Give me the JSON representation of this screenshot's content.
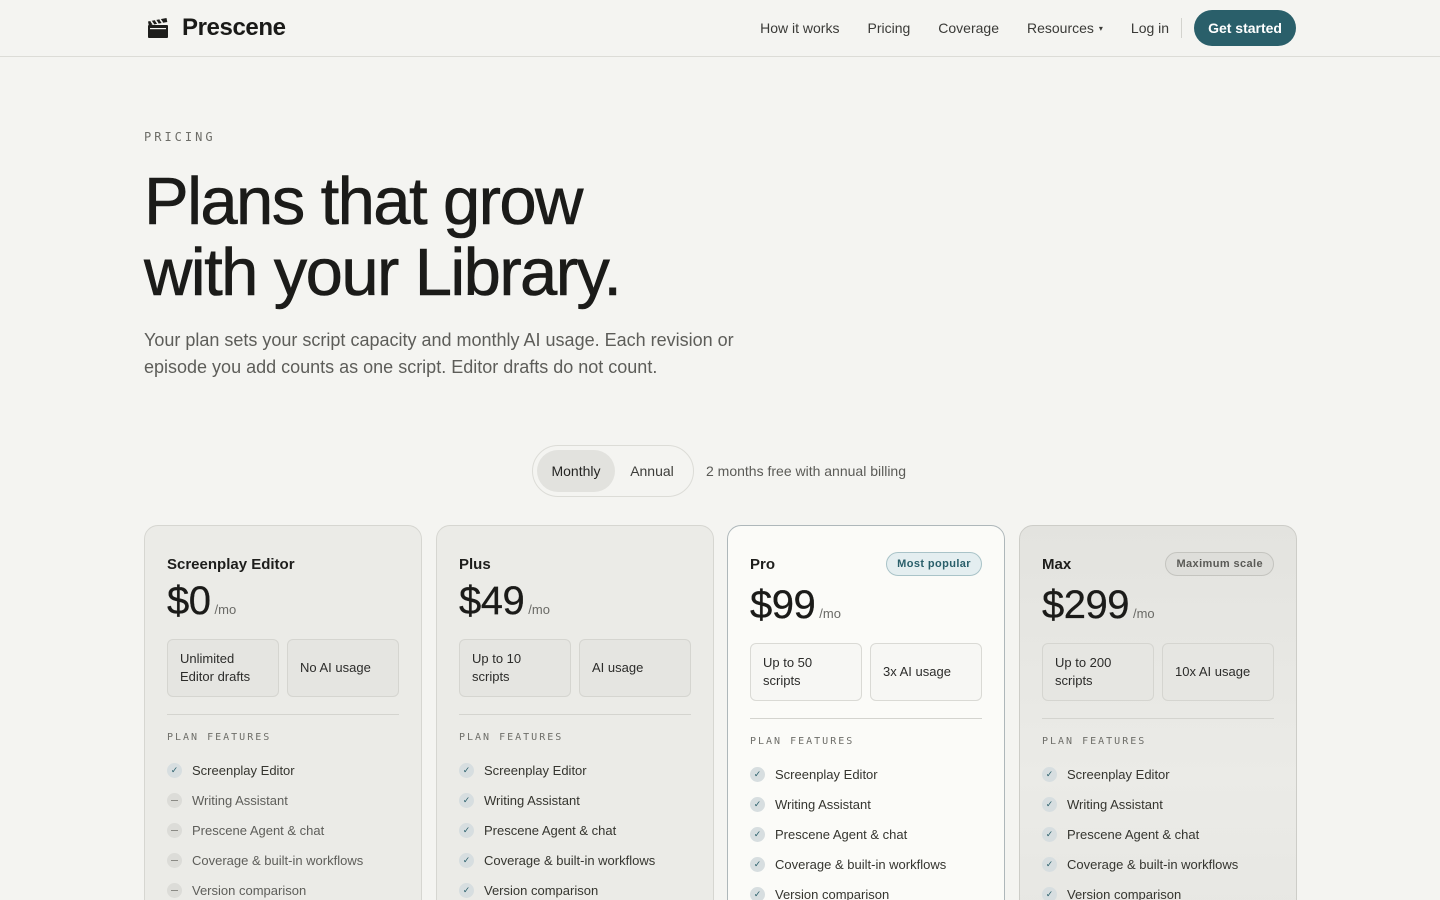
{
  "nav": {
    "brand": "Prescene",
    "brand_icon": "clapperboard-icon",
    "links": [
      "How it works",
      "Pricing",
      "Coverage",
      "Resources"
    ],
    "resources_caret": "▾",
    "login": "Log in",
    "cta": "Get started"
  },
  "hero": {
    "eyebrow": "PRICING",
    "title_line1": "Plans that grow",
    "title_line2": "with your Library.",
    "subtitle": "Your plan sets your script capacity and monthly AI usage. Each revision or episode you add counts as one script. Editor drafts do not count."
  },
  "billing": {
    "monthly": "Monthly",
    "annual": "Annual",
    "selected": "Monthly",
    "note": "2 months free with annual billing"
  },
  "plans": [
    {
      "name": "Screenplay Editor",
      "price": "$0",
      "per": "/mo",
      "stat1": "Unlimited Editor drafts",
      "stat2": "No AI usage",
      "features_title": "PLAN FEATURES",
      "features": [
        {
          "label": "Screenplay Editor",
          "included": true
        },
        {
          "label": "Writing Assistant",
          "included": false
        },
        {
          "label": "Prescene Agent & chat",
          "included": false
        },
        {
          "label": "Coverage & built-in workflows",
          "included": false
        },
        {
          "label": "Version comparison",
          "included": false
        }
      ]
    },
    {
      "name": "Plus",
      "price": "$49",
      "per": "/mo",
      "stat1": "Up to 10 scripts",
      "stat2": "AI usage",
      "features_title": "PLAN FEATURES",
      "features": [
        {
          "label": "Screenplay Editor",
          "included": true
        },
        {
          "label": "Writing Assistant",
          "included": true
        },
        {
          "label": "Prescene Agent & chat",
          "included": true
        },
        {
          "label": "Coverage & built-in workflows",
          "included": true
        },
        {
          "label": "Version comparison",
          "included": true
        }
      ]
    },
    {
      "name": "Pro",
      "badge": "Most popular",
      "price": "$99",
      "per": "/mo",
      "stat1": "Up to 50 scripts",
      "stat2": "3x AI usage",
      "features_title": "PLAN FEATURES",
      "features": [
        {
          "label": "Screenplay Editor",
          "included": true
        },
        {
          "label": "Writing Assistant",
          "included": true
        },
        {
          "label": "Prescene Agent & chat",
          "included": true
        },
        {
          "label": "Coverage & built-in workflows",
          "included": true
        },
        {
          "label": "Version comparison",
          "included": true
        }
      ]
    },
    {
      "name": "Max",
      "badge": "Maximum scale",
      "price": "$299",
      "per": "/mo",
      "stat1": "Up to 200 scripts",
      "stat2": "10x AI usage",
      "features_title": "PLAN FEATURES",
      "features": [
        {
          "label": "Screenplay Editor",
          "included": true
        },
        {
          "label": "Writing Assistant",
          "included": true
        },
        {
          "label": "Prescene Agent & chat",
          "included": true
        },
        {
          "label": "Coverage & built-in workflows",
          "included": true
        },
        {
          "label": "Version comparison",
          "included": true
        }
      ]
    }
  ],
  "colors": {
    "background": "#f4f4f1",
    "accent": "#2a5f6a",
    "text": "#1c1c1a"
  }
}
